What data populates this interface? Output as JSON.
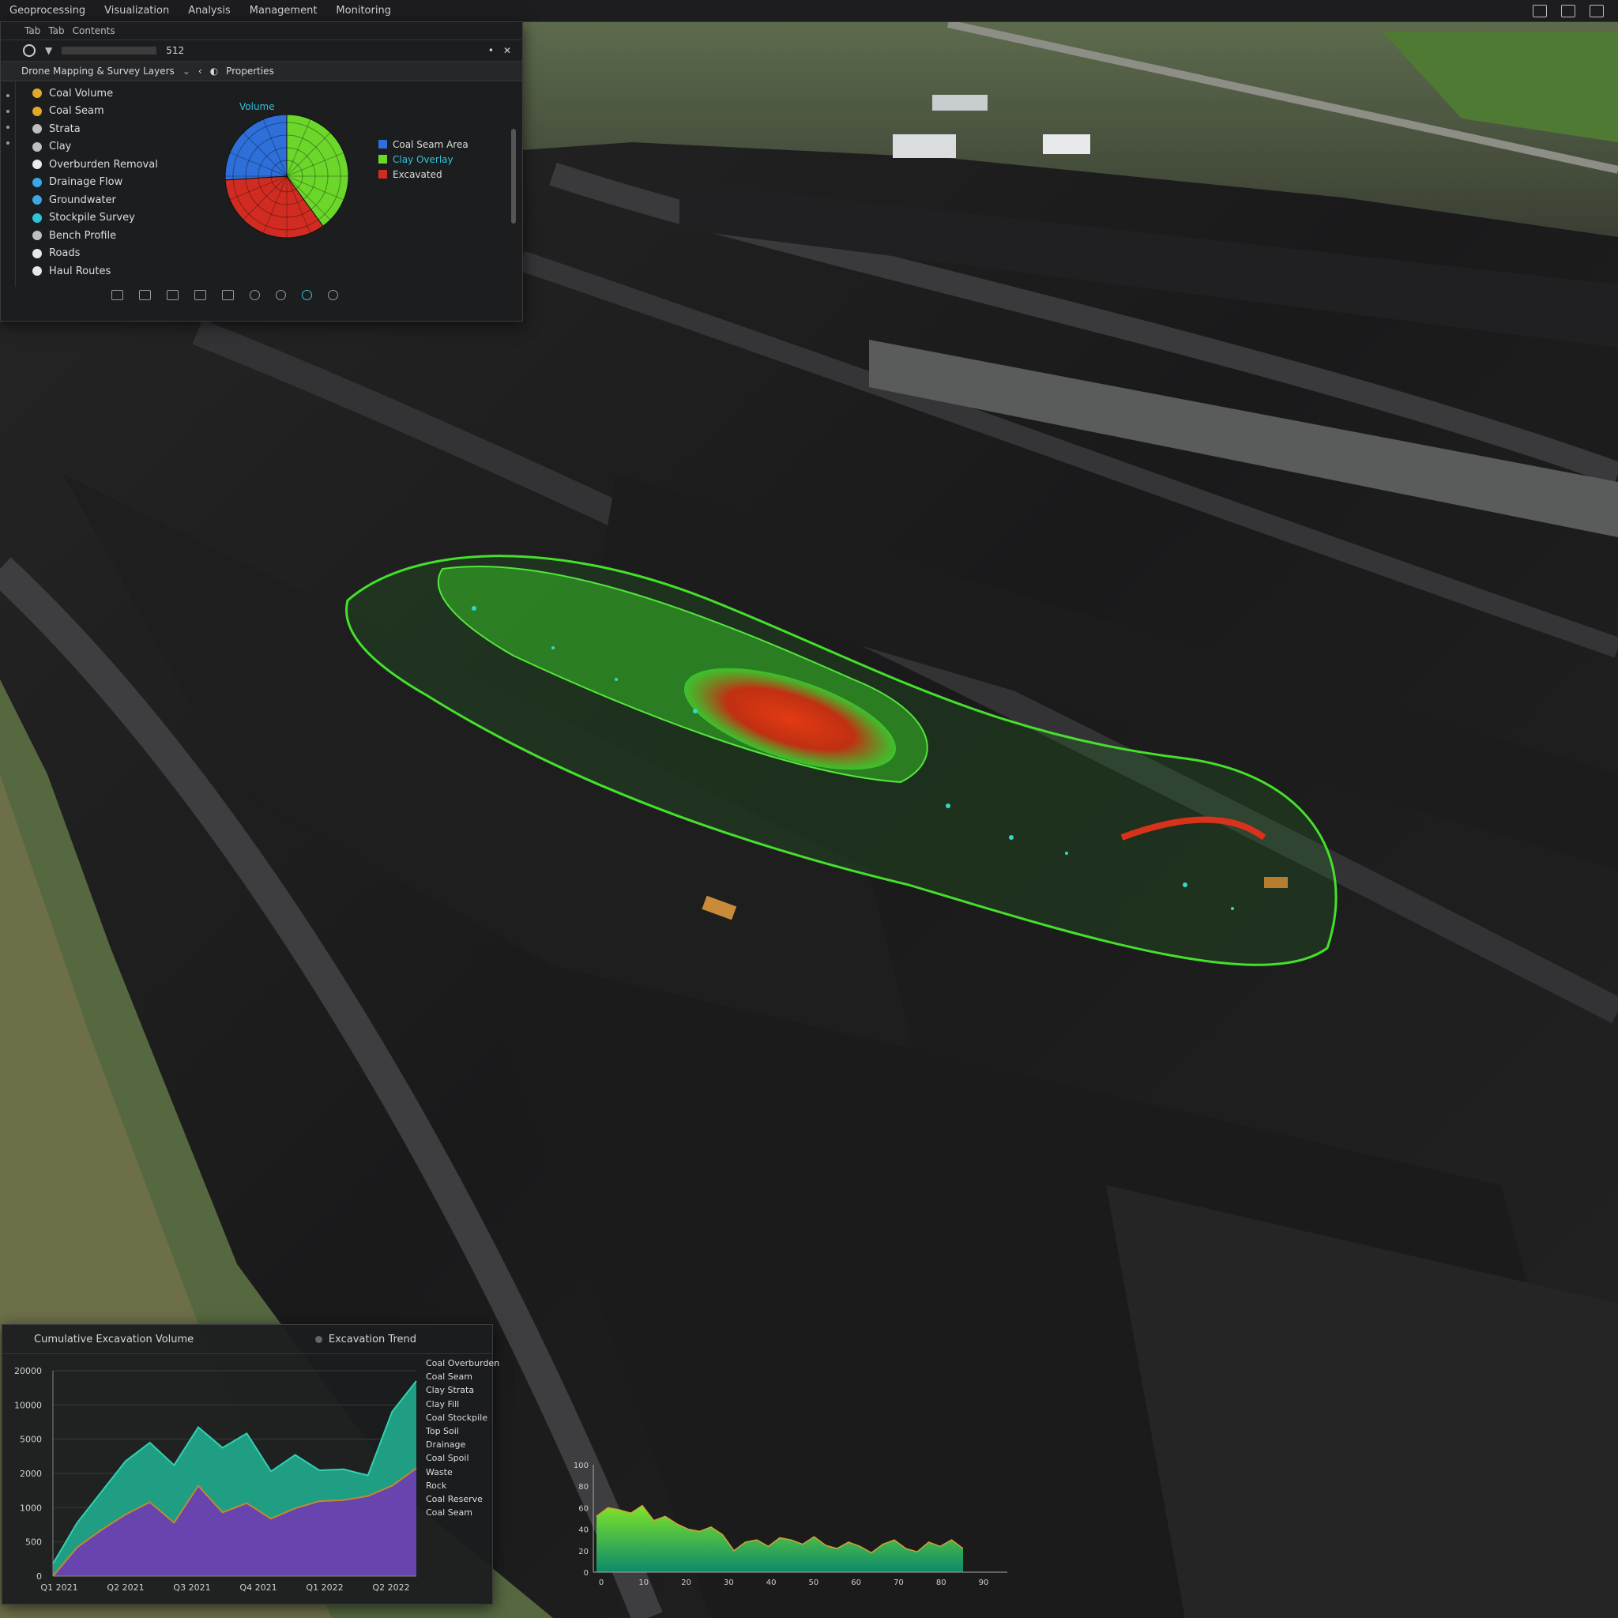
{
  "menubar": {
    "items": [
      "Geoprocessing",
      "Visualization",
      "Analysis",
      "Management",
      "Monitoring"
    ]
  },
  "layers_panel": {
    "tabs": [
      "Tab",
      "Tab",
      "Contents"
    ],
    "toolbar_value": "512",
    "header_title": "Drone Mapping & Survey Layers",
    "header_right": "Properties",
    "items": [
      {
        "label": "Coal Volume",
        "color": "#e0a92a"
      },
      {
        "label": "Coal Seam",
        "color": "#e0a92a"
      },
      {
        "label": "Strata",
        "color": "#bfbfbf"
      },
      {
        "label": "Clay",
        "color": "#bfbfbf"
      },
      {
        "label": "Overburden Removal",
        "color": "#ececec"
      },
      {
        "label": "Drainage Flow",
        "color": "#3aa7e6"
      },
      {
        "label": "Groundwater",
        "color": "#3aa7e6"
      },
      {
        "label": "Stockpile Survey",
        "color": "#2ec4d8"
      },
      {
        "label": "Bench Profile",
        "color": "#bfbfbf"
      },
      {
        "label": "Roads",
        "color": "#e8e8e8"
      },
      {
        "label": "Haul Routes",
        "color": "#e8e8e8"
      }
    ],
    "chart_badge": "Volume",
    "legend": [
      {
        "label": "Coal Seam Area",
        "color": "#2e6fd9"
      },
      {
        "label": "Clay Overlay",
        "color": "#6bd72a"
      },
      {
        "label": "Excavated",
        "color": "#d12c22"
      }
    ],
    "colors": {
      "accent": "#2ec4d8",
      "bg": "#1c1d1f"
    }
  },
  "trend_panel": {
    "title": "Cumulative Excavation Volume",
    "title_right": "Excavation Trend",
    "legend": [
      "Coal Overburden",
      "Coal Seam",
      "Clay Strata",
      "Clay Fill",
      "Coal Stockpile",
      "Top Soil",
      "Drainage",
      "Coal Spoil",
      "Waste",
      "Rock",
      "Coal Reserve",
      "Coal Seam"
    ],
    "colors": {
      "area_top": "#20a58a",
      "area_bottom": "#6b3fb0"
    }
  },
  "chart_data": [
    {
      "type": "pie",
      "title": "",
      "slices": [
        {
          "name": "Clay Overlay",
          "value": 40,
          "color": "#6bd72a"
        },
        {
          "name": "Excavated",
          "value": 34,
          "color": "#d12c22"
        },
        {
          "name": "Coal Seam Area",
          "value": 26,
          "color": "#2e6fd9"
        }
      ]
    },
    {
      "type": "area",
      "title": "Cumulative Excavation Volume",
      "xlabel": "",
      "ylabel": "",
      "y_ticks": [
        "20000",
        "10000",
        "5000",
        "2000",
        "1000",
        "500",
        "0"
      ],
      "x_ticks": [
        "Q1 2021",
        "Q2 2021",
        "Q3 2021",
        "Q4 2021",
        "Q1 2022",
        "Q2 2022"
      ],
      "ylim": [
        0,
        20000
      ],
      "x": [
        0,
        1,
        2,
        3,
        4,
        5,
        6,
        7,
        8,
        9,
        10,
        11,
        12,
        13,
        14,
        15
      ],
      "series": [
        {
          "name": "",
          "values": [
            1200,
            5200,
            8200,
            11200,
            13000,
            10800,
            14500,
            12500,
            13900,
            10200,
            11800,
            10300,
            10400,
            9800,
            16000,
            19000
          ]
        },
        {
          "name": "",
          "values": [
            0,
            2800,
            4500,
            6000,
            7200,
            5200,
            8800,
            6200,
            7100,
            5600,
            6600,
            7300,
            7400,
            7800,
            8800,
            10500
          ]
        }
      ]
    },
    {
      "type": "area",
      "title": "",
      "y_ticks": [
        "100",
        "80",
        "60",
        "40",
        "20",
        "0"
      ],
      "x_ticks": [
        "0",
        "10",
        "20",
        "30",
        "40",
        "50",
        "60",
        "70",
        "80",
        "90"
      ],
      "ylim": [
        0,
        100
      ],
      "values": [
        52,
        60,
        58,
        55,
        62,
        48,
        52,
        45,
        40,
        38,
        42,
        35,
        20,
        28,
        30,
        24,
        32,
        30,
        26,
        33,
        25,
        22,
        28,
        24,
        18,
        26,
        30,
        22,
        19,
        28,
        24,
        30,
        22
      ]
    }
  ]
}
